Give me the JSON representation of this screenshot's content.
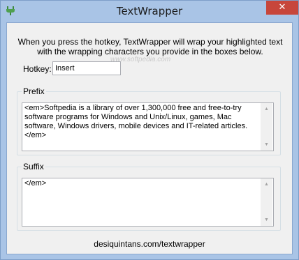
{
  "window": {
    "title": "TextWrapper",
    "close_glyph": "✕",
    "icon": "plug-icon"
  },
  "intro_text": "When you press the hotkey, TextWrapper will wrap your highlighted text with the wrapping characters you provide in the boxes below.",
  "watermark": "www.softpedia.com",
  "hotkey": {
    "label": "Hotkey:",
    "value": "Insert"
  },
  "prefix": {
    "legend": "Prefix",
    "value": "<em>Softpedia is a library of over 1,300,000 free and free-to-try software programs for Windows and Unix/Linux, games, Mac software, Windows drivers, mobile devices and IT-related articles.</em>"
  },
  "suffix": {
    "legend": "Suffix",
    "value": "</em>"
  },
  "footer": {
    "link": "desiquintans.com/textwrapper"
  },
  "colors": {
    "frame": "#a9c4e6",
    "close_button": "#c7463b",
    "client": "#f0f0f0"
  }
}
